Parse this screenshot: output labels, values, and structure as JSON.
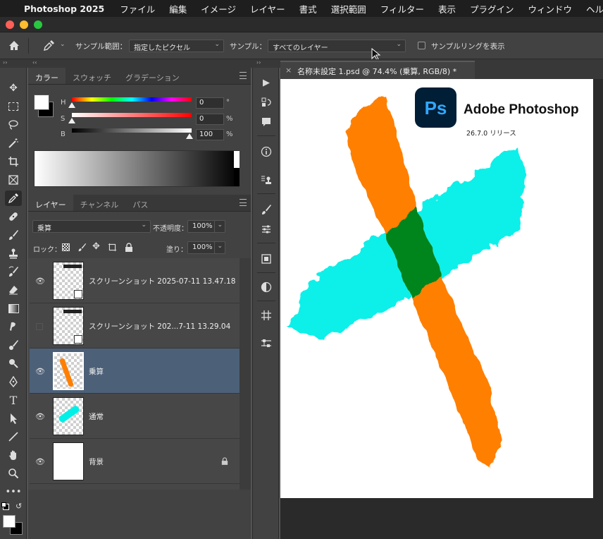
{
  "menubar": {
    "app_name": "Photoshop 2025",
    "items": [
      "ファイル",
      "編集",
      "イメージ",
      "レイヤー",
      "書式",
      "選択範囲",
      "フィルター",
      "表示",
      "プラグイン",
      "ウィンドウ",
      "ヘル"
    ]
  },
  "options": {
    "sample_size_label": "サンプル範囲：",
    "sample_size_value": "指定したピクセル",
    "sample_label": "サンプル：",
    "sample_value": "すべてのレイヤー",
    "sampling_ring_label": "サンプルリングを表示"
  },
  "color_panel": {
    "tabs": [
      "カラー",
      "スウォッチ",
      "グラデーション"
    ],
    "h_label": "H",
    "s_label": "S",
    "b_label": "B",
    "h_value": "0",
    "s_value": "0",
    "b_value": "100",
    "h_unit": "°",
    "s_unit": "%",
    "b_unit": "%",
    "foreground": "#ffffff",
    "background": "#000000"
  },
  "layers_panel": {
    "tabs": [
      "レイヤー",
      "チャンネル",
      "パス"
    ],
    "blend_mode": "乗算",
    "opacity_label": "不透明度：",
    "opacity_value": "100%",
    "lock_label": "ロック：",
    "fill_label": "塗り：",
    "fill_value": "100%",
    "layers": [
      {
        "name": "スクリーンショット 2025-07-11 13.47.18",
        "visible": true
      },
      {
        "name": "スクリーンショット 202...7-11 13.29.04",
        "visible": false
      },
      {
        "name": "乗算",
        "visible": true,
        "selected": true
      },
      {
        "name": "通常",
        "visible": true
      },
      {
        "name": "背景",
        "visible": true,
        "locked": true
      }
    ]
  },
  "document": {
    "tab_title": "名称未設定 1.psd @ 74.4% (乗算, RGB/8) *",
    "close_glyph": "×",
    "splash_app": "Adobe Photoshop",
    "splash_logo": "Ps",
    "splash_version": "26.7.0 リリース"
  },
  "colors": {
    "orange": "#ff7f00",
    "cyan": "#00f0e8",
    "overlap": "#00841e",
    "selected_layer": "#4c6078",
    "ps_blue": "#31a8ff",
    "ps_bg": "#001e36"
  }
}
